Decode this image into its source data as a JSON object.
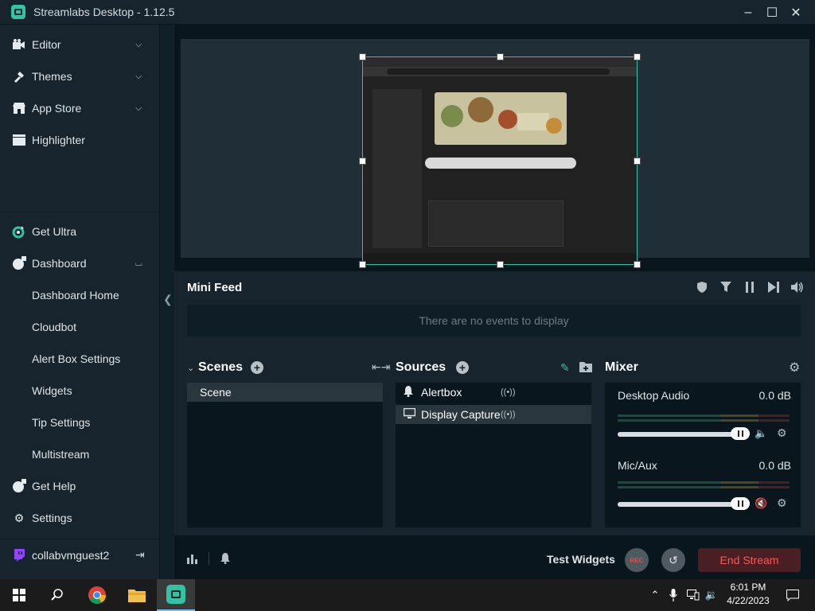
{
  "window": {
    "title": "Streamlabs Desktop - 1.12.5"
  },
  "sidebar": {
    "items": [
      {
        "label": "Editor",
        "icon": "editor-icon"
      },
      {
        "label": "Themes",
        "icon": "themes-icon"
      },
      {
        "label": "App Store",
        "icon": "app-store-icon"
      },
      {
        "label": "Highlighter",
        "icon": "highlighter-icon"
      }
    ],
    "lower": [
      {
        "label": "Get Ultra"
      },
      {
        "label": "Dashboard"
      }
    ],
    "dashboard_sub": [
      "Dashboard Home",
      "Cloudbot",
      "Alert Box Settings",
      "Widgets",
      "Tip Settings",
      "Multistream"
    ],
    "get_help": "Get Help",
    "settings": "Settings",
    "user": "collabvmguest2"
  },
  "minifeed": {
    "title": "Mini Feed",
    "empty": "There are no events to display"
  },
  "scenes": {
    "title": "Scenes",
    "items": [
      "Scene"
    ]
  },
  "sources": {
    "title": "Sources",
    "items": [
      "Alertbox",
      "Display Capture"
    ]
  },
  "mixer": {
    "title": "Mixer",
    "channels": [
      {
        "name": "Desktop Audio",
        "db": "0.0 dB"
      },
      {
        "name": "Mic/Aux",
        "db": "0.0 dB"
      }
    ]
  },
  "footer": {
    "test_widgets": "Test Widgets",
    "rec": "REC",
    "end_stream": "End Stream"
  },
  "taskbar": {
    "time": "6:01 PM",
    "date": "4/22/2023"
  },
  "colors": {
    "accent": "#31c3a2",
    "end_stream_text": "#f55a5a",
    "sidebar_bg": "#17242d"
  }
}
